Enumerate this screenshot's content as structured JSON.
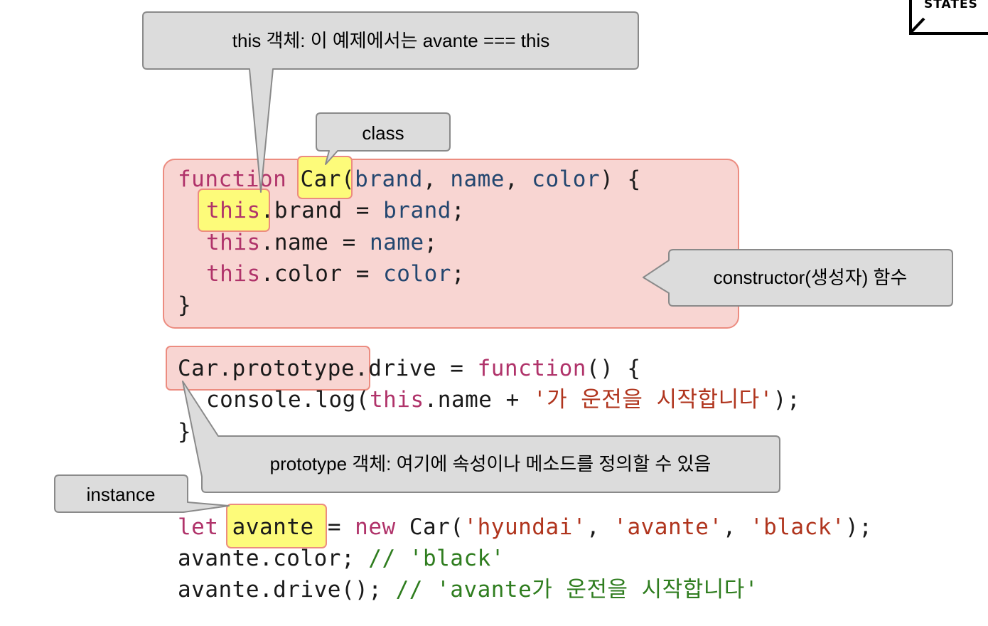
{
  "logo": {
    "text": "STATES"
  },
  "callouts": {
    "this_object": "this 객체: 이 예제에서는 avante === this",
    "class": "class",
    "constructor": "constructor(생성자) 함수",
    "prototype_object": "prototype 객체: 여기에 속성이나 메소드를 정의할 수 있음",
    "instance": "instance"
  },
  "code": {
    "l1": {
      "kw": "function",
      "cls": "Car",
      "p1": "(",
      "a1": "brand",
      "c1": ", ",
      "a2": "name",
      "c2": ", ",
      "a3": "color",
      "p2": ") {"
    },
    "l2": {
      "kw": "this",
      "prop": ".brand = ",
      "val": "brand",
      "end": ";"
    },
    "l3": {
      "kw": "this",
      "prop": ".name = ",
      "val": "name",
      "end": ";"
    },
    "l4": {
      "kw": "this",
      "prop": ".color = ",
      "val": "color",
      "end": ";"
    },
    "l5": {
      "text": "}"
    },
    "l6": {
      "pre": "Car.prototype.drive = ",
      "kw": "function",
      "post": "() {"
    },
    "l7": {
      "pre": "console.log(",
      "kw": "this",
      "mid": ".name + ",
      "str": "'가 운전을 시작합니다'",
      "end": ");"
    },
    "l8": {
      "text": "}"
    },
    "l9": {
      "kw": "let",
      "var": "avante",
      "eq": " = ",
      "kw2": "new",
      "call": " Car(",
      "s1": "'hyundai'",
      "c1": ", ",
      "s2": "'avante'",
      "c2": ", ",
      "s3": "'black'",
      "end": ");"
    },
    "l10": {
      "pre": "avante.color; ",
      "cm": "// 'black'"
    },
    "l11": {
      "pre": "avante.drive(); ",
      "cm": "// 'avante가 운전을 시작합니다'"
    }
  },
  "colors": {
    "keyword": "#b0336a",
    "identifier": "#23466f",
    "string": "#b0351e",
    "comment": "#2f7d1f",
    "highlight_red": "#f8d5d2",
    "highlight_red_border": "#ec8c80",
    "highlight_yellow": "#fdfb7a",
    "callout_fill": "#dcdcdc",
    "callout_border": "#8a8a8a"
  }
}
